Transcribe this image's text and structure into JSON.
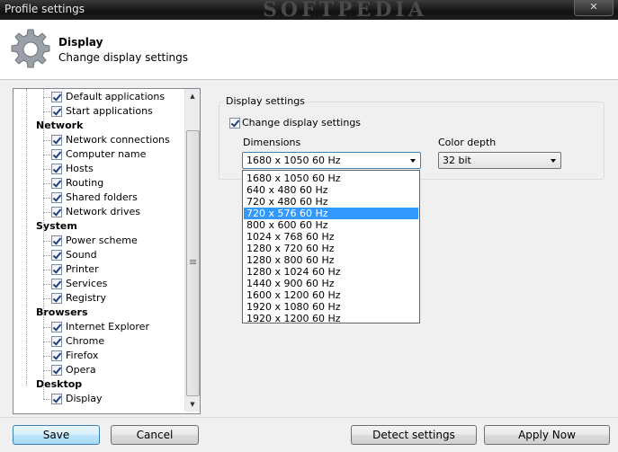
{
  "window": {
    "title": "Profile settings",
    "close_glyph": "✕",
    "watermark": "SOFTPEDIA"
  },
  "header": {
    "icon": "gear-icon",
    "title": "Display",
    "subtitle": "Change display settings"
  },
  "tree": {
    "items": [
      {
        "label": "Default applications",
        "level": 2,
        "checked": true
      },
      {
        "label": "Start applications",
        "level": 2,
        "checked": true
      },
      {
        "label": "Network",
        "level": 1
      },
      {
        "label": "Network connections",
        "level": 2,
        "checked": true
      },
      {
        "label": "Computer name",
        "level": 2,
        "checked": true
      },
      {
        "label": "Hosts",
        "level": 2,
        "checked": true
      },
      {
        "label": "Routing",
        "level": 2,
        "checked": true
      },
      {
        "label": "Shared folders",
        "level": 2,
        "checked": true
      },
      {
        "label": "Network drives",
        "level": 2,
        "checked": true
      },
      {
        "label": "System",
        "level": 1
      },
      {
        "label": "Power scheme",
        "level": 2,
        "checked": true
      },
      {
        "label": "Sound",
        "level": 2,
        "checked": true
      },
      {
        "label": "Printer",
        "level": 2,
        "checked": true
      },
      {
        "label": "Services",
        "level": 2,
        "checked": true
      },
      {
        "label": "Registry",
        "level": 2,
        "checked": true
      },
      {
        "label": "Browsers",
        "level": 1
      },
      {
        "label": "Internet Explorer",
        "level": 2,
        "checked": true
      },
      {
        "label": "Chrome",
        "level": 2,
        "checked": true
      },
      {
        "label": "Firefox",
        "level": 2,
        "checked": true
      },
      {
        "label": "Opera",
        "level": 2,
        "checked": true
      },
      {
        "label": "Desktop",
        "level": 1
      },
      {
        "label": "Display",
        "level": 2,
        "checked": true
      }
    ]
  },
  "display_settings": {
    "legend": "Display settings",
    "change_checkbox": {
      "label": "Change display settings",
      "checked": true
    },
    "dimensions_label": "Dimensions",
    "dimensions_value": "1680 x 1050 60 Hz",
    "color_depth_label": "Color depth",
    "color_depth_value": "32 bit",
    "dimension_options": [
      "1680 x 1050 60 Hz",
      "640 x 480 60 Hz",
      "720 x 480 60 Hz",
      "720 x 576 60 Hz",
      "800 x 600 60 Hz",
      "1024 x 768 60 Hz",
      "1280 x 720 60 Hz",
      "1280 x 800 60 Hz",
      "1280 x 1024 60 Hz",
      "1440 x 900 60 Hz",
      "1600 x 1200 60 Hz",
      "1920 x 1080 60 Hz",
      "1920 x 1200 60 Hz"
    ],
    "highlighted_option": "720 x 576 60 Hz"
  },
  "buttons": {
    "save": "Save",
    "cancel": "Cancel",
    "detect": "Detect settings",
    "apply": "Apply Now"
  },
  "colors": {
    "selection": "#3399ff",
    "title_bar": "#1e1e1e"
  }
}
